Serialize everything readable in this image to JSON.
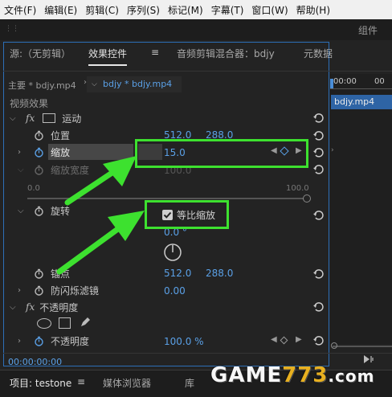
{
  "menu": [
    "文件(F)",
    "编辑(E)",
    "剪辑(C)",
    "序列(S)",
    "标记(M)",
    "字幕(T)",
    "窗口(W)",
    "帮助(H)"
  ],
  "top_right_label": "组件",
  "tabs": {
    "source": "源:（无剪辑）",
    "effect_controls": "效果控件",
    "menu_glyph": "≡",
    "audio_mixer": "音频剪辑混合器：bdjy",
    "metadata": "元数据"
  },
  "clip_header": {
    "master": "主要 * bdjy.mp4",
    "sequence": "bdjy * bdjy.mp4",
    "timecode_start": "00:00",
    "timecode_next": "00",
    "clip_name": "bdjy.mp4"
  },
  "section_video": "视频效果",
  "motion": {
    "label": "运动",
    "position": {
      "label": "位置",
      "x": "512.0",
      "y": "288.0"
    },
    "scale": {
      "label": "缩放",
      "value": "15.0"
    },
    "scale_width": {
      "label": "缩放宽度",
      "value": "100.0"
    },
    "slider_min": "0.0",
    "slider_max": "100.0",
    "uniform_scale": {
      "label": "等比缩放",
      "checked": true
    },
    "rotation": {
      "label": "旋转",
      "value": "0.0 °"
    },
    "anchor": {
      "label": "锚点",
      "x": "512.0",
      "y": "288.0"
    },
    "anti_flicker": {
      "label": "防闪烁滤镜",
      "value": "0.00"
    }
  },
  "opacity": {
    "label": "不透明度",
    "value_label": "不透明度",
    "value": "100.0 %"
  },
  "timecode": "00:00:00:00",
  "bottom": {
    "project": "项目: testone",
    "menu_glyph": "≡",
    "media_browser": "媒体浏览器",
    "library": "库"
  },
  "watermark": {
    "main": "GAME",
    "sub": "773",
    "tld": ".com"
  },
  "colors": {
    "accent_blue": "#5aa0e6",
    "highlight_green": "#3de12f",
    "panel_bg": "#232323"
  }
}
